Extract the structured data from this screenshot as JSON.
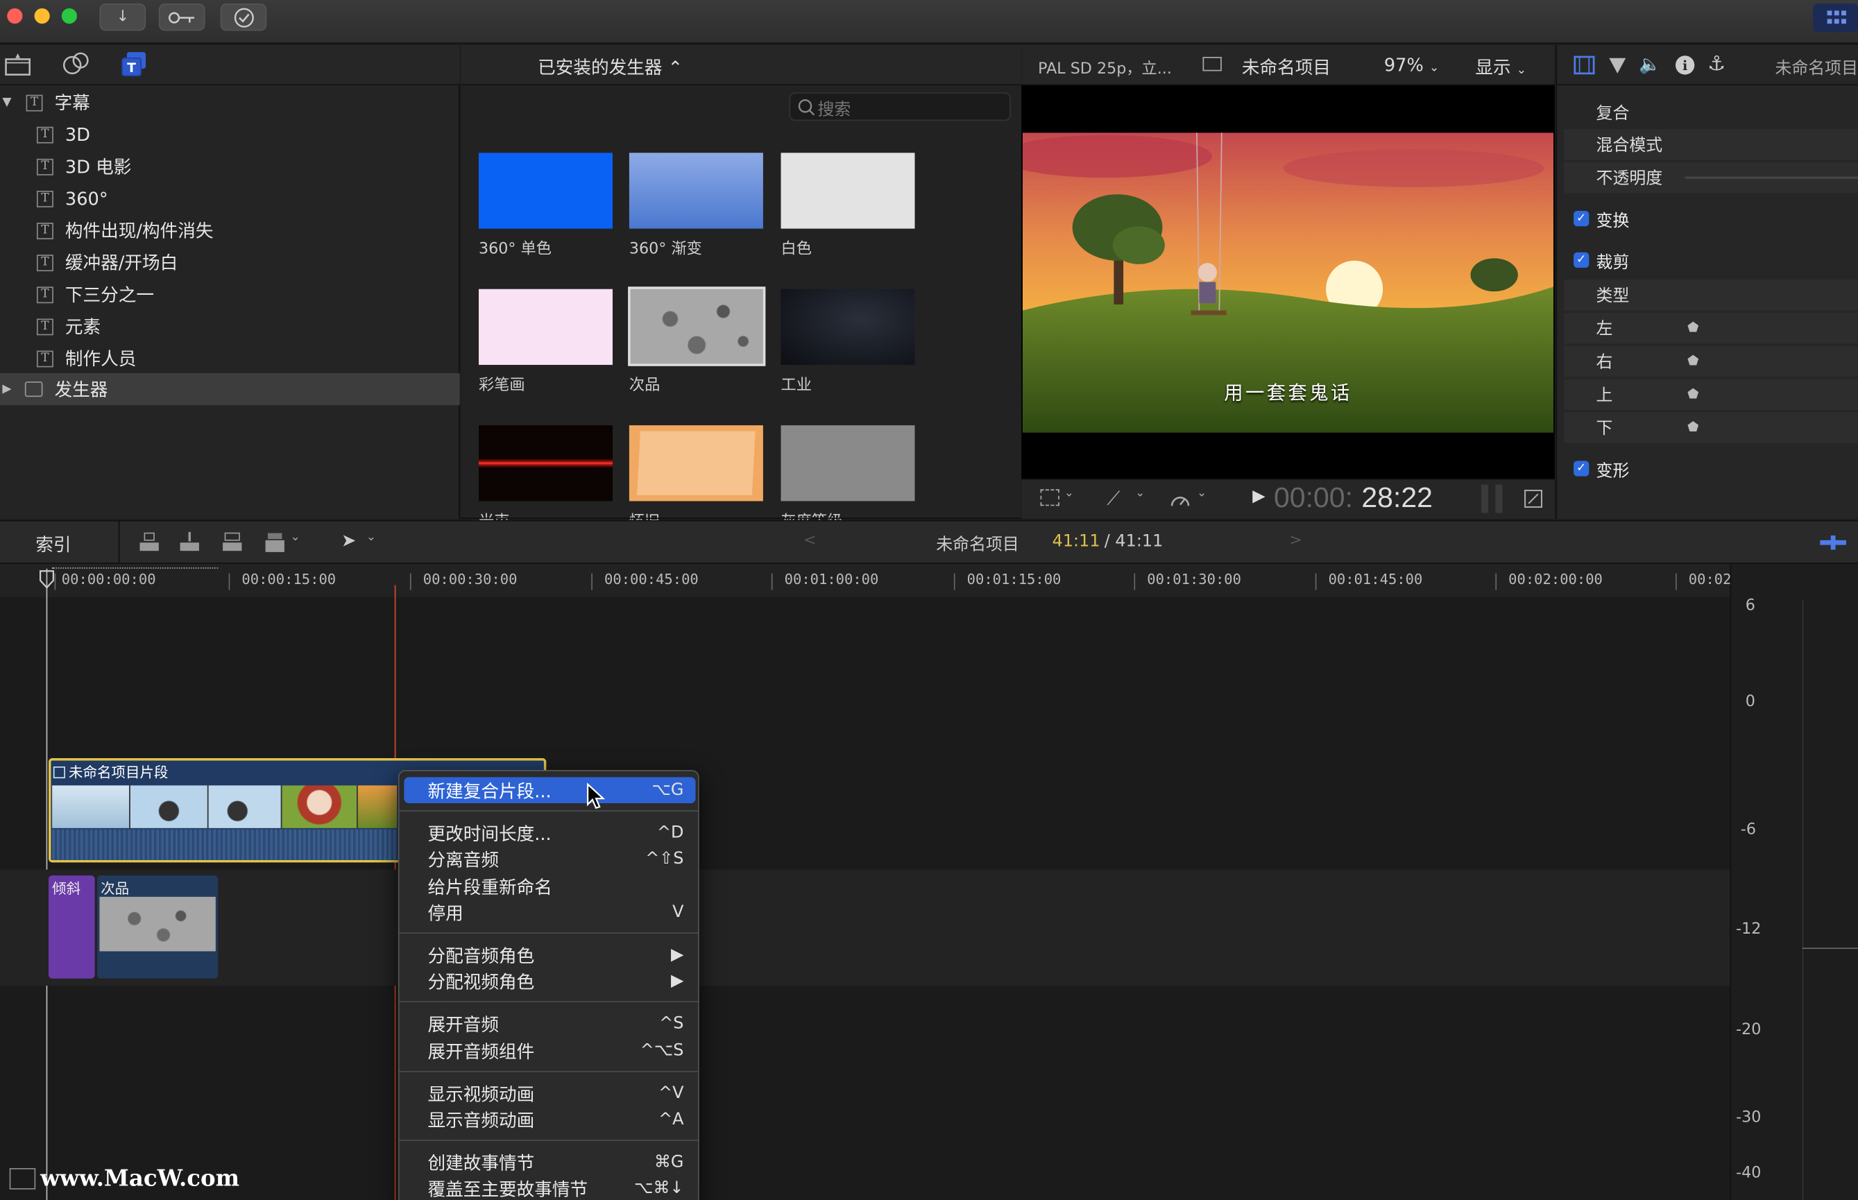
{
  "titlebar": {
    "icons": [
      "import-icon",
      "keyword-icon",
      "check-icon",
      "grid-icon"
    ]
  },
  "library": {
    "tabs": [
      "libraries-icon",
      "photos-audio-icon",
      "titles-generators-icon"
    ],
    "items": [
      {
        "label": "字幕",
        "expanded": true
      },
      {
        "label": "3D"
      },
      {
        "label": "3D 电影"
      },
      {
        "label": "360°"
      },
      {
        "label": "构件出现/构件消失"
      },
      {
        "label": "缓冲器/开场白"
      },
      {
        "label": "下三分之一"
      },
      {
        "label": "元素"
      },
      {
        "label": "制作人员"
      },
      {
        "label": "发生器",
        "selected": true
      }
    ]
  },
  "browser": {
    "header": "已安装的发生器 ⌃",
    "search_placeholder": "搜索",
    "items": [
      {
        "label": "360° 单色",
        "color": "#0a62f5"
      },
      {
        "label": "360° 渐变",
        "color": "#6a93d8"
      },
      {
        "label": "白色",
        "color": "#e3e3e3"
      },
      {
        "label": "彩笔画",
        "color": "#f8e2f3"
      },
      {
        "label": "次品",
        "color": "#9a9a9a"
      },
      {
        "label": "工业",
        "color": "#141820"
      },
      {
        "label": "光束",
        "color": "#120606"
      },
      {
        "label": "怀旧",
        "color": "#f4c089"
      },
      {
        "label": "灰度等级",
        "color": "#8a8a8a"
      }
    ]
  },
  "viewer": {
    "format": "PAL SD 25p，立...",
    "project": "未命名项目",
    "zoom": "97%",
    "display": "显示",
    "subtitle": "用一套套鬼话",
    "timecode_dim": "00:00:",
    "timecode": "28:22"
  },
  "inspector": {
    "title": "未命名项目",
    "rows": {
      "composite": "复合",
      "blend": "混合模式",
      "opacity": "不透明度",
      "transform": "变换",
      "crop": "裁剪",
      "type": "类型",
      "left": "左",
      "right": "右",
      "top": "上",
      "bottom": "下",
      "distort": "变形"
    }
  },
  "timeline": {
    "index": "索引",
    "project": "未命名项目",
    "position": "41:11",
    "duration": "/ 41:11",
    "ruler": [
      "00:00:00:00",
      "00:00:15:00",
      "00:00:30:00",
      "00:00:45:00",
      "00:01:00:00",
      "00:01:15:00",
      "00:01:30:00",
      "00:01:45:00",
      "00:02:00:00",
      "00:02"
    ],
    "clip_title": "未命名项目片段",
    "clip_b": "倾斜",
    "clip_c": "次品",
    "meter": [
      "6",
      "0",
      "-6",
      "-12",
      "-20",
      "-30",
      "-40"
    ]
  },
  "menu": {
    "items": [
      {
        "label": "新建复合片段...",
        "shortcut": "⌥G",
        "highlighted": true
      },
      {
        "label": "更改时间长度...",
        "shortcut": "^D"
      },
      {
        "label": "分离音频",
        "shortcut": "^⇧S"
      },
      {
        "label": "给片段重新命名",
        "shortcut": ""
      },
      {
        "label": "停用",
        "shortcut": "V"
      },
      {
        "label": "分配音频角色",
        "shortcut": "▶"
      },
      {
        "label": "分配视频角色",
        "shortcut": "▶"
      },
      {
        "label": "展开音频",
        "shortcut": "^S"
      },
      {
        "label": "展开音频组件",
        "shortcut": "^⌥S"
      },
      {
        "label": "显示视频动画",
        "shortcut": "^V"
      },
      {
        "label": "显示音频动画",
        "shortcut": "^A"
      },
      {
        "label": "创建故事情节",
        "shortcut": "⌘G"
      },
      {
        "label": "覆盖至主要故事情节",
        "shortcut": "⌥⌘↓"
      }
    ]
  },
  "watermark": "www.MacW.com"
}
